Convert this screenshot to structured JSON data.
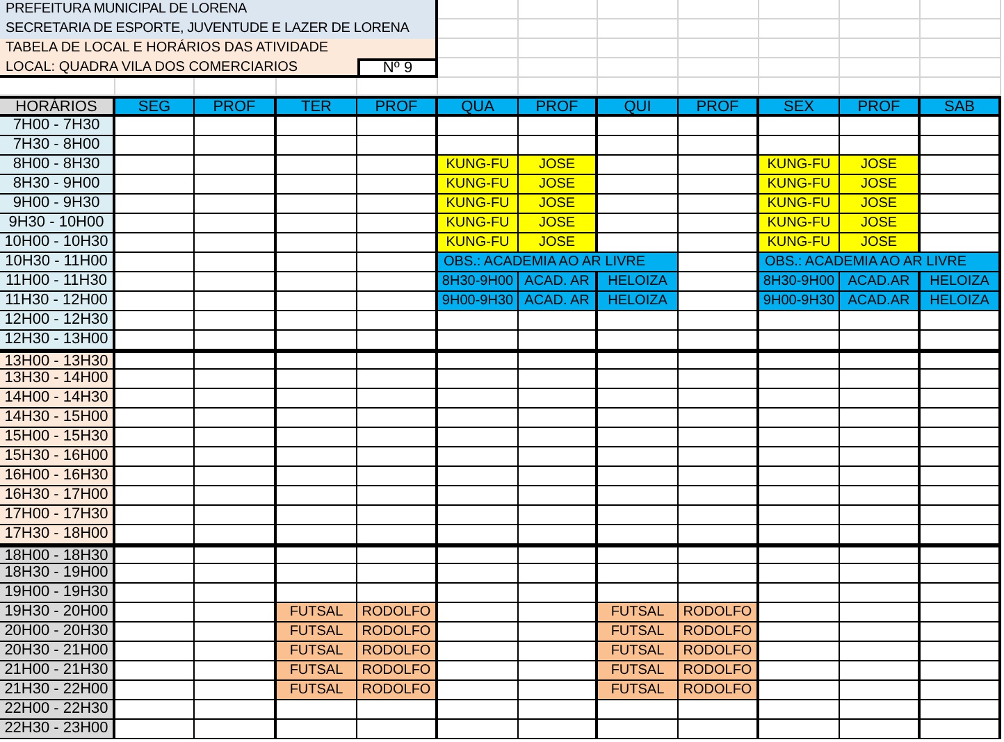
{
  "header": {
    "lines": [
      "PREFEITURA MUNICIPAL DE LORENA",
      "SECRETARIA DE ESPORTE, JUVENTUDE E LAZER DE LORENA"
    ],
    "subtitle": "TABELA DE LOCAL E HORÁRIOS DAS ATIVIDADE",
    "location": "LOCAL: QUADRA VILA DOS COMERCIARIOS",
    "number": "Nº 9"
  },
  "table": {
    "time_column": "HORÁRIOS",
    "columns": [
      "SEG",
      "PROF",
      "TER",
      "PROF",
      "QUA",
      "PROF",
      "QUI",
      "PROF",
      "SEX",
      "PROF",
      "SAB"
    ],
    "rows": [
      {
        "time": "7H00 - 7H30",
        "color": "#daeef3",
        "cells": [
          null,
          null,
          null,
          null,
          null,
          null,
          null,
          null,
          null,
          null,
          null
        ]
      },
      {
        "time": "7H30 - 8H00",
        "color": "#daeef3",
        "cells": [
          null,
          null,
          null,
          null,
          null,
          null,
          null,
          null,
          null,
          null,
          null
        ]
      },
      {
        "time": "8H00 - 8H30",
        "color": "#daeef3",
        "cells": [
          null,
          null,
          null,
          null,
          {
            "kind": "entry",
            "text": "KUNG-FU",
            "color": "#ffff00"
          },
          {
            "kind": "entry",
            "text": "JOSE",
            "color": "#ffff00"
          },
          null,
          null,
          {
            "kind": "entry",
            "text": "KUNG-FU",
            "color": "#ffff00"
          },
          {
            "kind": "entry",
            "text": "JOSE",
            "color": "#ffff00"
          },
          null
        ]
      },
      {
        "time": "8H30 - 9H00",
        "color": "#daeef3",
        "cells": [
          null,
          null,
          null,
          null,
          {
            "kind": "entry",
            "text": "KUNG-FU",
            "color": "#ffff00"
          },
          {
            "kind": "entry",
            "text": "JOSE",
            "color": "#ffff00"
          },
          null,
          null,
          {
            "kind": "entry",
            "text": "KUNG-FU",
            "color": "#ffff00"
          },
          {
            "kind": "entry",
            "text": "JOSE",
            "color": "#ffff00"
          },
          null
        ]
      },
      {
        "time": "9H00 - 9H30",
        "color": "#daeef3",
        "cells": [
          null,
          null,
          null,
          null,
          {
            "kind": "entry",
            "text": "KUNG-FU",
            "color": "#ffff00"
          },
          {
            "kind": "entry",
            "text": "JOSE",
            "color": "#ffff00"
          },
          null,
          null,
          {
            "kind": "entry",
            "text": "KUNG-FU",
            "color": "#ffff00"
          },
          {
            "kind": "entry",
            "text": "JOSE",
            "color": "#ffff00"
          },
          null
        ]
      },
      {
        "time": "9H30 - 10H00",
        "color": "#daeef3",
        "cells": [
          null,
          null,
          null,
          null,
          {
            "kind": "entry",
            "text": "KUNG-FU",
            "color": "#ffff00"
          },
          {
            "kind": "entry",
            "text": "JOSE",
            "color": "#ffff00"
          },
          null,
          null,
          {
            "kind": "entry",
            "text": "KUNG-FU",
            "color": "#ffff00"
          },
          {
            "kind": "entry",
            "text": "JOSE",
            "color": "#ffff00"
          },
          null
        ]
      },
      {
        "time": "10H00 - 10H30",
        "color": "#daeef3",
        "cells": [
          null,
          null,
          null,
          null,
          {
            "kind": "entry",
            "text": "KUNG-FU",
            "color": "#ffff00"
          },
          {
            "kind": "entry",
            "text": "JOSE",
            "color": "#ffff00"
          },
          null,
          null,
          {
            "kind": "entry",
            "text": "KUNG-FU",
            "color": "#ffff00"
          },
          {
            "kind": "entry",
            "text": "JOSE",
            "color": "#ffff00"
          },
          null
        ]
      },
      {
        "time": "10H30 - 11H00",
        "color": "#daeef3",
        "cells": [
          null,
          null,
          null,
          null,
          {
            "kind": "note",
            "text": "OBS.: ACADEMIA AO AR LIVRE",
            "color": "#00b0f0"
          },
          null,
          null,
          null,
          {
            "kind": "note",
            "text": "OBS.: ACADEMIA AO AR LIVRE",
            "color": "#00b0f0"
          },
          null,
          null
        ]
      },
      {
        "time": "11H00 - 11H30",
        "color": "#daeef3",
        "cells": [
          null,
          null,
          null,
          null,
          {
            "kind": "entry",
            "text": "8H30-9H00",
            "color": "#00b0f0"
          },
          {
            "kind": "entry",
            "text": "ACAD. AR",
            "color": "#00b0f0"
          },
          {
            "kind": "entry",
            "text": "HELOIZA",
            "color": "#00b0f0"
          },
          null,
          {
            "kind": "entry",
            "text": "8H30-9H00",
            "color": "#00b0f0"
          },
          {
            "kind": "entry",
            "text": "ACAD.AR",
            "color": "#00b0f0"
          },
          {
            "kind": "entry",
            "text": "HELOIZA",
            "color": "#00b0f0"
          }
        ]
      },
      {
        "time": "11H30 - 12H00",
        "color": "#daeef3",
        "cells": [
          null,
          null,
          null,
          null,
          {
            "kind": "entry",
            "text": "9H00-9H30",
            "color": "#00b0f0"
          },
          {
            "kind": "entry",
            "text": "ACAD. AR",
            "color": "#00b0f0"
          },
          {
            "kind": "entry",
            "text": "HELOIZA",
            "color": "#00b0f0"
          },
          null,
          {
            "kind": "entry",
            "text": "9H00-9H30",
            "color": "#00b0f0"
          },
          {
            "kind": "entry",
            "text": "ACAD.AR",
            "color": "#00b0f0"
          },
          {
            "kind": "entry",
            "text": "HELOIZA",
            "color": "#00b0f0"
          }
        ]
      },
      {
        "time": "12H00 - 12H30",
        "color": "#daeef3",
        "cells": [
          null,
          null,
          null,
          null,
          null,
          null,
          null,
          null,
          null,
          null,
          null
        ]
      },
      {
        "time": "12H30 - 13H00",
        "color": "#daeef3",
        "cells": [
          null,
          null,
          null,
          null,
          null,
          null,
          null,
          null,
          null,
          null,
          null
        ]
      },
      {
        "time": "13H00 - 13H30",
        "color": "#fde9d9",
        "cells": [
          null,
          null,
          null,
          null,
          null,
          null,
          null,
          null,
          null,
          null,
          null
        ]
      },
      {
        "time": "13H30 - 14H00",
        "color": "#fde9d9",
        "cells": [
          null,
          null,
          null,
          null,
          null,
          null,
          null,
          null,
          null,
          null,
          null
        ]
      },
      {
        "time": "14H00 - 14H30",
        "color": "#fde9d9",
        "cells": [
          null,
          null,
          null,
          null,
          null,
          null,
          null,
          null,
          null,
          null,
          null
        ]
      },
      {
        "time": "14H30 - 15H00",
        "color": "#fde9d9",
        "cells": [
          null,
          null,
          null,
          null,
          null,
          null,
          null,
          null,
          null,
          null,
          null
        ]
      },
      {
        "time": "15H00 - 15H30",
        "color": "#fde9d9",
        "cells": [
          null,
          null,
          null,
          null,
          null,
          null,
          null,
          null,
          null,
          null,
          null
        ]
      },
      {
        "time": "15H30 - 16H00",
        "color": "#fde9d9",
        "cells": [
          null,
          null,
          null,
          null,
          null,
          null,
          null,
          null,
          null,
          null,
          null
        ]
      },
      {
        "time": "16H00 - 16H30",
        "color": "#fde9d9",
        "cells": [
          null,
          null,
          null,
          null,
          null,
          null,
          null,
          null,
          null,
          null,
          null
        ]
      },
      {
        "time": "16H30 - 17H00",
        "color": "#fde9d9",
        "cells": [
          null,
          null,
          null,
          null,
          null,
          null,
          null,
          null,
          null,
          null,
          null
        ]
      },
      {
        "time": "17H00 - 17H30",
        "color": "#fde9d9",
        "cells": [
          null,
          null,
          null,
          null,
          null,
          null,
          null,
          null,
          null,
          null,
          null
        ]
      },
      {
        "time": "17H30 - 18H00",
        "color": "#fde9d9",
        "cells": [
          null,
          null,
          null,
          null,
          null,
          null,
          null,
          null,
          null,
          null,
          null
        ]
      },
      {
        "time": "18H00 - 18H30",
        "color": "#d9d9d9",
        "cells": [
          null,
          null,
          null,
          null,
          null,
          null,
          null,
          null,
          null,
          null,
          null
        ]
      },
      {
        "time": "18H30 - 19H00",
        "color": "#d9d9d9",
        "cells": [
          null,
          null,
          null,
          null,
          null,
          null,
          null,
          null,
          null,
          null,
          null
        ]
      },
      {
        "time": "19H00 - 19H30",
        "color": "#d9d9d9",
        "cells": [
          null,
          null,
          null,
          null,
          null,
          null,
          null,
          null,
          null,
          null,
          null
        ]
      },
      {
        "time": "19H30 - 20H00",
        "color": "#d9d9d9",
        "cells": [
          null,
          null,
          {
            "kind": "entry",
            "text": "FUTSAL",
            "color": "#fac090"
          },
          {
            "kind": "entry",
            "text": "RODOLFO",
            "color": "#fac090"
          },
          null,
          null,
          {
            "kind": "entry",
            "text": "FUTSAL",
            "color": "#fac090"
          },
          {
            "kind": "entry",
            "text": "RODOLFO",
            "color": "#fac090"
          },
          null,
          null,
          null
        ]
      },
      {
        "time": "20H00 - 20H30",
        "color": "#d9d9d9",
        "cells": [
          null,
          null,
          {
            "kind": "entry",
            "text": "FUTSAL",
            "color": "#fac090"
          },
          {
            "kind": "entry",
            "text": "RODOLFO",
            "color": "#fac090"
          },
          null,
          null,
          {
            "kind": "entry",
            "text": "FUTSAL",
            "color": "#fac090"
          },
          {
            "kind": "entry",
            "text": "RODOLFO",
            "color": "#fac090"
          },
          null,
          null,
          null
        ]
      },
      {
        "time": "20H30 - 21H00",
        "color": "#d9d9d9",
        "cells": [
          null,
          null,
          {
            "kind": "entry",
            "text": "FUTSAL",
            "color": "#fac090"
          },
          {
            "kind": "entry",
            "text": "RODOLFO",
            "color": "#fac090"
          },
          null,
          null,
          {
            "kind": "entry",
            "text": "FUTSAL",
            "color": "#fac090"
          },
          {
            "kind": "entry",
            "text": "RODOLFO",
            "color": "#fac090"
          },
          null,
          null,
          null
        ]
      },
      {
        "time": "21H00 - 21H30",
        "color": "#d9d9d9",
        "cells": [
          null,
          null,
          {
            "kind": "entry",
            "text": "FUTSAL",
            "color": "#fac090"
          },
          {
            "kind": "entry",
            "text": "RODOLFO",
            "color": "#fac090"
          },
          null,
          null,
          {
            "kind": "entry",
            "text": "FUTSAL",
            "color": "#fac090"
          },
          {
            "kind": "entry",
            "text": "RODOLFO",
            "color": "#fac090"
          },
          null,
          null,
          null
        ]
      },
      {
        "time": "21H30 - 22H00",
        "color": "#d9d9d9",
        "cells": [
          null,
          null,
          {
            "kind": "entry",
            "text": "FUTSAL",
            "color": "#fac090"
          },
          {
            "kind": "entry",
            "text": "RODOLFO",
            "color": "#fac090"
          },
          null,
          null,
          {
            "kind": "entry",
            "text": "FUTSAL",
            "color": "#fac090"
          },
          {
            "kind": "entry",
            "text": "RODOLFO",
            "color": "#fac090"
          },
          null,
          null,
          null
        ]
      },
      {
        "time": "22H00 - 22H30",
        "color": "#d9d9d9",
        "cells": [
          null,
          null,
          null,
          null,
          null,
          null,
          null,
          null,
          null,
          null,
          null
        ]
      },
      {
        "time": "22H30 - 23H00",
        "color": "#d9d9d9",
        "cells": [
          null,
          null,
          null,
          null,
          null,
          null,
          null,
          null,
          null,
          null,
          null
        ]
      }
    ]
  }
}
